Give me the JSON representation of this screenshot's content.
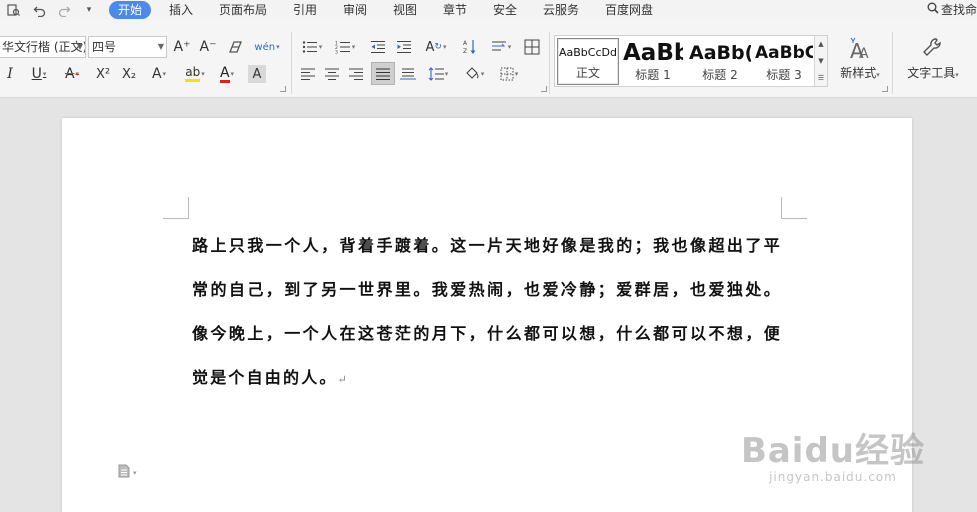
{
  "quick_access": {
    "icons": [
      "preview-icon",
      "undo-icon",
      "redo-icon",
      "customize-dropdown-icon"
    ]
  },
  "menu": {
    "tabs": [
      {
        "label": "开始",
        "active": true
      },
      {
        "label": "插入"
      },
      {
        "label": "页面布局"
      },
      {
        "label": "引用"
      },
      {
        "label": "审阅"
      },
      {
        "label": "视图"
      },
      {
        "label": "章节"
      },
      {
        "label": "安全"
      },
      {
        "label": "云服务"
      },
      {
        "label": "百度网盘"
      }
    ],
    "search_label": "查找命"
  },
  "ribbon": {
    "font_name": "华文行楷 (正文)",
    "font_size": "四号",
    "buttons": {
      "grow_font": "A⁺",
      "shrink_font": "A⁻",
      "clear_format": "⌫",
      "phonetic": "wén",
      "italic": "I",
      "underline": "U",
      "strikethrough": "A",
      "superscript": "X²",
      "subscript": "X₂",
      "text_effect": "A",
      "highlight": "ab",
      "font_color": "A",
      "char_shading": "A"
    },
    "styles": [
      {
        "sample": "AaBbCcDd",
        "name": "正文",
        "selected": true
      },
      {
        "sample": "AaBb",
        "name": "标题 1"
      },
      {
        "sample": "AaBb(",
        "name": "标题 2"
      },
      {
        "sample": "AaBbC",
        "name": "标题 3"
      }
    ],
    "new_style_label": "新样式",
    "text_tools_label": "文字工具",
    "colors": {
      "accent": "#4c8ae6",
      "highlight_bar": "#f2e600",
      "font_color_bar": "#e01e1e"
    }
  },
  "document": {
    "paragraph": "路上只我一个人，背着手踱着。这一片天地好像是我的；我也像超出了平常的自己，到了另一世界里。我爱热闹，也爱冷静；爱群居，也爱独处。像今晚上，一个人在这苍茫的月下，什么都可以想，什么都可以不想，便觉是个自由的人。",
    "paragraph_mark": "↵"
  },
  "watermark": {
    "brand": "Baidu经验",
    "url": "jingyan.baidu.com"
  }
}
